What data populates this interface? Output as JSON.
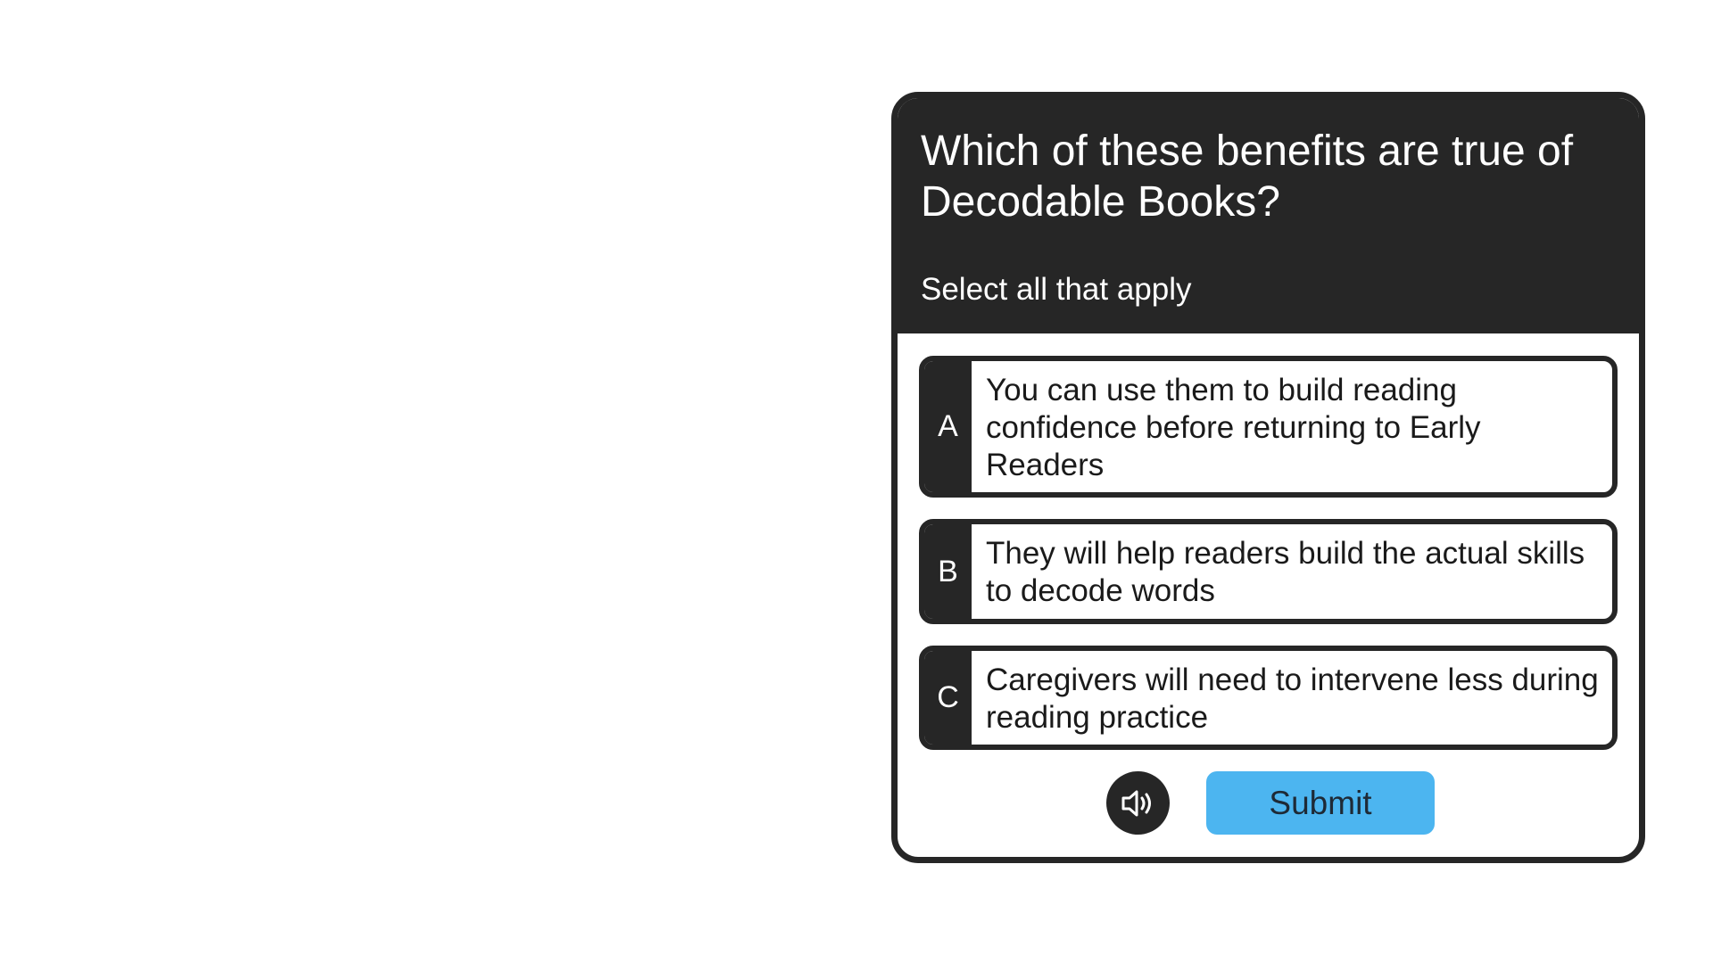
{
  "quiz": {
    "question": "Which of these benefits are true of Decodable Books?",
    "instruction": "Select all that apply",
    "options": [
      {
        "letter": "A",
        "text": "You can use them to build reading confidence before returning to Early Readers"
      },
      {
        "letter": "B",
        "text": "They will help readers build the actual skills to decode words"
      },
      {
        "letter": "C",
        "text": "Caregivers will need to intervene less during reading practice"
      }
    ],
    "submit_label": "Submit",
    "audio_icon": "speaker-icon"
  },
  "colors": {
    "card_dark": "#262626",
    "submit_bg": "#4cb5f0",
    "background": "#ffffff"
  }
}
